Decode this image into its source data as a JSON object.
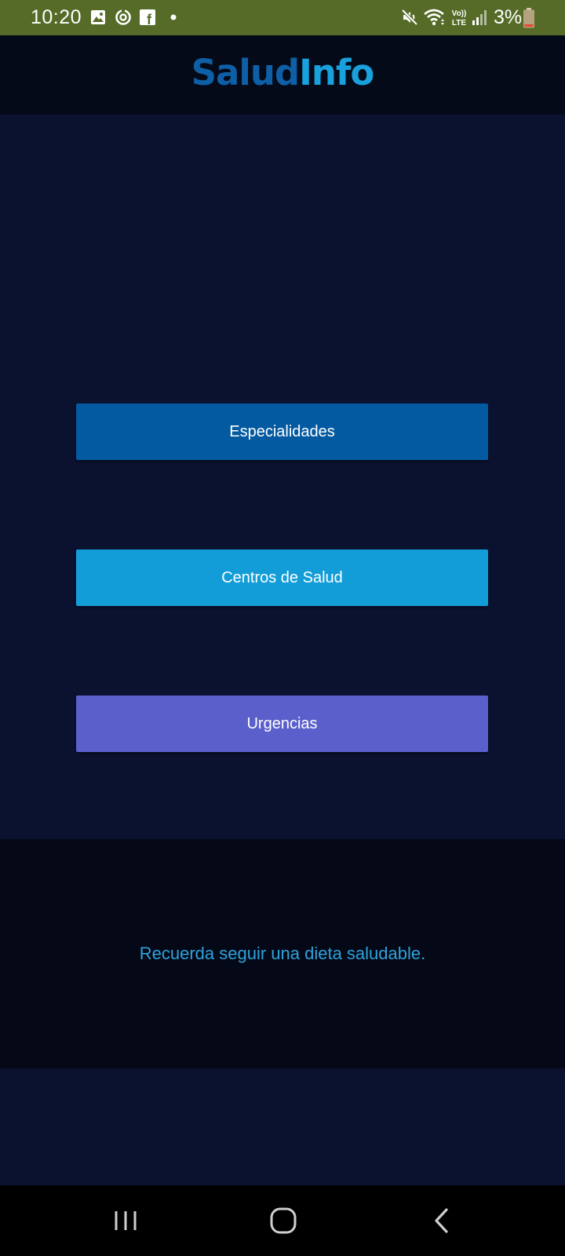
{
  "status_bar": {
    "time": "10:20",
    "battery_percent": "3%",
    "notification_icons": [
      "gallery-icon",
      "sync-icon",
      "facebook-icon",
      "dot-icon"
    ],
    "system_icons": [
      "mute-icon",
      "wifi-icon",
      "volte-lte-icon",
      "signal-icon",
      "battery-icon"
    ],
    "volte_label_top": "Vo))",
    "volte_label_bottom": "LTE",
    "facebook_glyph": "f",
    "color": "#556b27"
  },
  "header": {
    "title_part1": "Salud",
    "title_part2": "Info",
    "title_color_1": "#0e5fa6",
    "title_color_2": "#18a1dc"
  },
  "menu": {
    "buttons": [
      {
        "label": "Especialidades",
        "color": "#045aa0"
      },
      {
        "label": "Centros de Salud",
        "color": "#139dd8"
      },
      {
        "label": "Urgencias",
        "color": "#5b5fcb"
      }
    ]
  },
  "tip": {
    "text": "Recuerda seguir una dieta saludable.",
    "color": "#2ea3dc"
  },
  "nav_bar": {
    "buttons": [
      "recent-apps-icon",
      "home-icon",
      "back-icon"
    ]
  }
}
